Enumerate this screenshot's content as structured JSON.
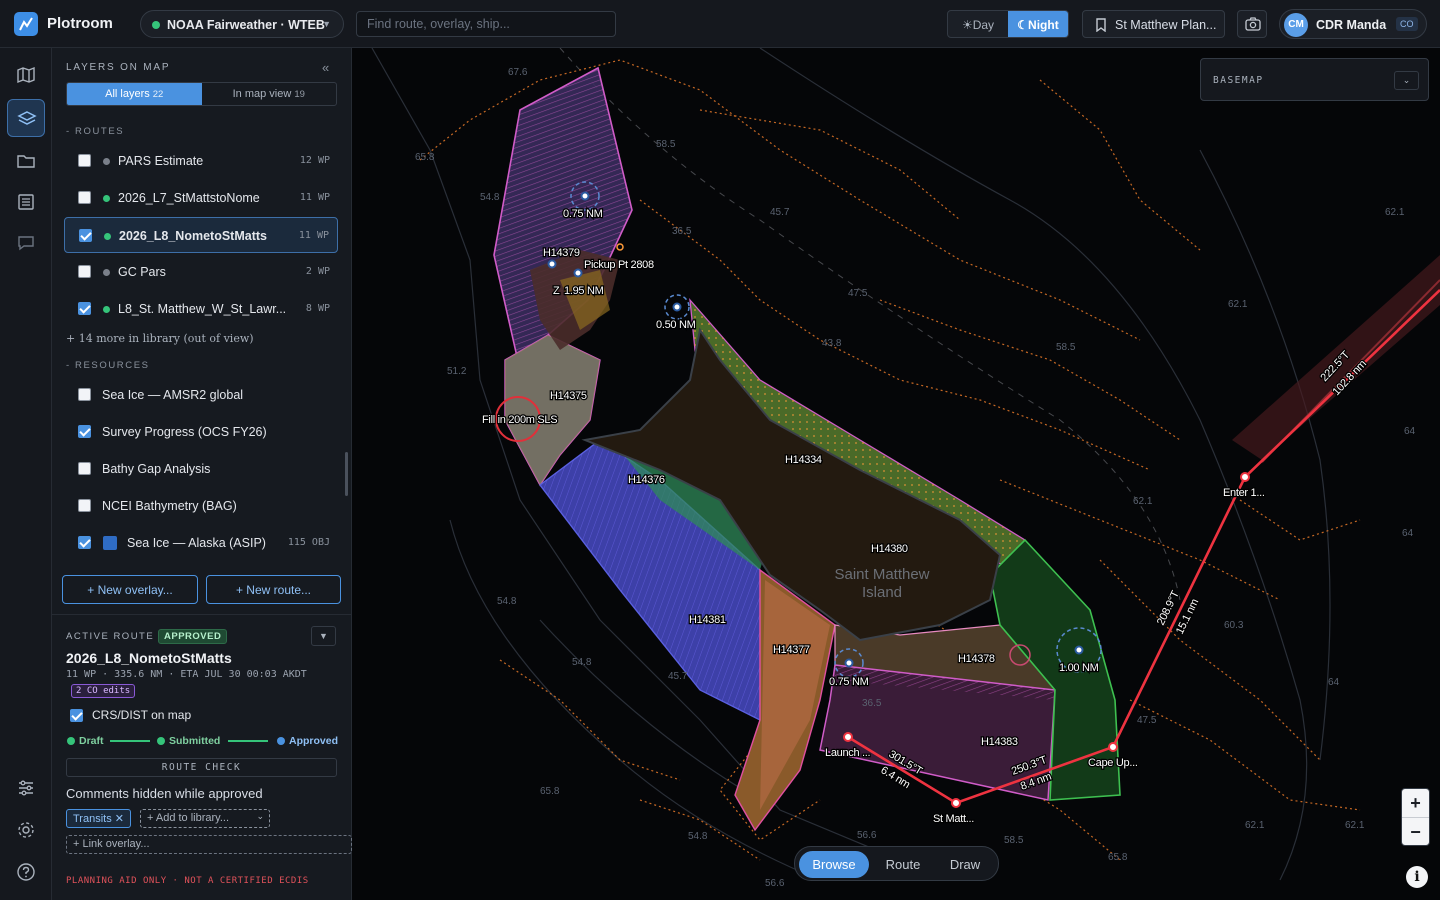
{
  "header": {
    "app_name": "Plotroom",
    "project": "NOAA Fairweather · WTEB",
    "search_placeholder": "Find route, overlay, ship...",
    "theme_day": "Day",
    "theme_night": "Night",
    "plan_label": "St Matthew Plan...",
    "user_initials": "CM",
    "user_name": "CDR Manda",
    "user_role": "CO"
  },
  "rail": {
    "icons": [
      "map-icon",
      "layers-icon",
      "folder-icon",
      "list-icon",
      "comment-icon",
      "sliders-icon",
      "gear-icon",
      "help-icon"
    ],
    "active": "layers-icon"
  },
  "panel": {
    "title": "LAYERS ON MAP",
    "tab_all": "All layers",
    "tab_all_count": "22",
    "tab_view": "In map view",
    "tab_view_count": "19",
    "routes_heading": "- ROUTES",
    "routes": [
      {
        "label": "PARS Estimate",
        "count": "12 WP",
        "checked": false,
        "dot": "#7a808a"
      },
      {
        "label": "2026_L7_StMattstoNome",
        "count": "11 WP",
        "checked": false,
        "dot": "#35c47a"
      },
      {
        "label": "2026_L8_NometoStMatts",
        "count": "11 WP",
        "checked": true,
        "dot": "#35c47a"
      },
      {
        "label": "GC Pars",
        "count": "2 WP",
        "checked": false,
        "dot": "#7a808a"
      },
      {
        "label": "L8_St. Matthew_W_St_Lawr...",
        "count": "8 WP",
        "checked": true,
        "dot": "#35c47a"
      }
    ],
    "more_link": "+ 14 more in library (out of view)",
    "resources_heading": "- RESOURCES",
    "resources": [
      {
        "label": "Sea Ice — AMSR2 global",
        "checked": false,
        "count": ""
      },
      {
        "label": "Survey Progress (OCS FY26)",
        "checked": true,
        "count": ""
      },
      {
        "label": "Bathy Gap Analysis",
        "checked": false,
        "count": ""
      },
      {
        "label": "NCEI Bathymetry (BAG)",
        "checked": false,
        "count": ""
      },
      {
        "label": "Sea Ice — Alaska (ASIP)",
        "checked": true,
        "count": "115 OBJ"
      }
    ],
    "new_overlay": "+ New overlay...",
    "new_route": "+ New route..."
  },
  "active_route": {
    "heading": "ACTIVE ROUTE",
    "status": "APPROVED",
    "name": "2026_L8_NometoStMatts",
    "meta": "11 WP · 335.6 NM · ETA JUL 30 00:03 AKDT",
    "co_edits": "2 CO edits",
    "crs_label": "CRS/DIST on map",
    "steps": [
      "Draft",
      "Submitted",
      "Approved"
    ],
    "route_check": "ROUTE CHECK",
    "comments_hidden": "Comments hidden while approved",
    "chip_transits": "Transits",
    "chip_add": "+ Add to library...",
    "chip_link": "+ Link overlay...",
    "footer": "PLANNING AID ONLY · NOT A CERTIFIED ECDIS"
  },
  "map": {
    "basemap_label": "BASEMAP",
    "island_name_1": "Saint Matthew",
    "island_name_2": "Island",
    "sheets": [
      "H14379",
      "H14375",
      "H14376",
      "H14334",
      "H14380",
      "H14381",
      "H14377",
      "H14378",
      "H14383"
    ],
    "radius_labels": [
      "0.75 NM",
      "1.95 NM",
      "0.50 NM",
      "0.75 NM",
      "1.00 NM"
    ],
    "pickup": "Pickup Pt 2808",
    "fill_label": "Fill in 200m SLS",
    "waypoints": [
      "Launch ...",
      "St Matt...",
      "Cape Up...",
      "Enter 1..."
    ],
    "legs": [
      {
        "course": "301.5°T",
        "dist": "6.4 nm"
      },
      {
        "course": "250.3°T",
        "dist": "8.4 nm"
      },
      {
        "course": "208.9°T",
        "dist": "15.1 nm"
      },
      {
        "course": "222.5°T",
        "dist": "102.8 nm"
      }
    ],
    "depths": [
      "67.6",
      "65.8",
      "54.8",
      "58.5",
      "45.7",
      "36.5",
      "47.5",
      "43.8",
      "51.2",
      "58.5",
      "62.1",
      "62.1",
      "62.1",
      "64",
      "64",
      "60.3",
      "64",
      "54.8",
      "54.8",
      "45.7",
      "36.5",
      "65.8",
      "56.6",
      "54.8",
      "58.5",
      "56.6",
      "65.8",
      "62.1",
      "62.1",
      "47.5"
    ],
    "modes": [
      "Browse",
      "Route",
      "Draw"
    ],
    "active_mode": "Browse"
  }
}
